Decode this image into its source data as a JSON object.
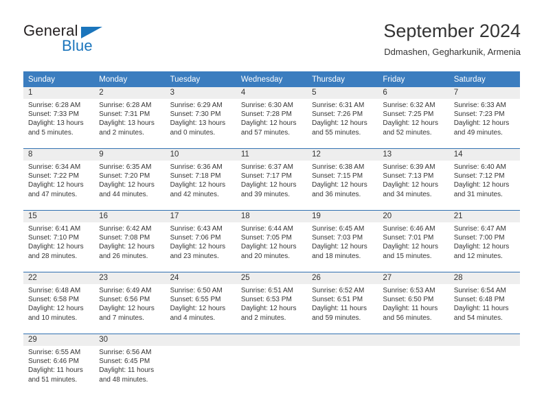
{
  "brand": {
    "name_part1": "General",
    "name_part2": "Blue",
    "flag_icon": "flag-triangle-icon"
  },
  "header": {
    "title": "September 2024",
    "subtitle": "Ddmashen, Gegharkunik, Armenia"
  },
  "colors": {
    "header_blue": "#3b7dbf",
    "row_divider_blue": "#2f6fb0",
    "daynum_band": "#eeeeee",
    "brand_blue": "#1b75bc",
    "text": "#333333"
  },
  "calendar": {
    "weekday_headers": [
      "Sunday",
      "Monday",
      "Tuesday",
      "Wednesday",
      "Thursday",
      "Friday",
      "Saturday"
    ],
    "weeks": [
      [
        {
          "day": "1",
          "sunrise": "Sunrise: 6:28 AM",
          "sunset": "Sunset: 7:33 PM",
          "daylight_line1": "Daylight: 13 hours",
          "daylight_line2": "and 5 minutes."
        },
        {
          "day": "2",
          "sunrise": "Sunrise: 6:28 AM",
          "sunset": "Sunset: 7:31 PM",
          "daylight_line1": "Daylight: 13 hours",
          "daylight_line2": "and 2 minutes."
        },
        {
          "day": "3",
          "sunrise": "Sunrise: 6:29 AM",
          "sunset": "Sunset: 7:30 PM",
          "daylight_line1": "Daylight: 13 hours",
          "daylight_line2": "and 0 minutes."
        },
        {
          "day": "4",
          "sunrise": "Sunrise: 6:30 AM",
          "sunset": "Sunset: 7:28 PM",
          "daylight_line1": "Daylight: 12 hours",
          "daylight_line2": "and 57 minutes."
        },
        {
          "day": "5",
          "sunrise": "Sunrise: 6:31 AM",
          "sunset": "Sunset: 7:26 PM",
          "daylight_line1": "Daylight: 12 hours",
          "daylight_line2": "and 55 minutes."
        },
        {
          "day": "6",
          "sunrise": "Sunrise: 6:32 AM",
          "sunset": "Sunset: 7:25 PM",
          "daylight_line1": "Daylight: 12 hours",
          "daylight_line2": "and 52 minutes."
        },
        {
          "day": "7",
          "sunrise": "Sunrise: 6:33 AM",
          "sunset": "Sunset: 7:23 PM",
          "daylight_line1": "Daylight: 12 hours",
          "daylight_line2": "and 49 minutes."
        }
      ],
      [
        {
          "day": "8",
          "sunrise": "Sunrise: 6:34 AM",
          "sunset": "Sunset: 7:22 PM",
          "daylight_line1": "Daylight: 12 hours",
          "daylight_line2": "and 47 minutes."
        },
        {
          "day": "9",
          "sunrise": "Sunrise: 6:35 AM",
          "sunset": "Sunset: 7:20 PM",
          "daylight_line1": "Daylight: 12 hours",
          "daylight_line2": "and 44 minutes."
        },
        {
          "day": "10",
          "sunrise": "Sunrise: 6:36 AM",
          "sunset": "Sunset: 7:18 PM",
          "daylight_line1": "Daylight: 12 hours",
          "daylight_line2": "and 42 minutes."
        },
        {
          "day": "11",
          "sunrise": "Sunrise: 6:37 AM",
          "sunset": "Sunset: 7:17 PM",
          "daylight_line1": "Daylight: 12 hours",
          "daylight_line2": "and 39 minutes."
        },
        {
          "day": "12",
          "sunrise": "Sunrise: 6:38 AM",
          "sunset": "Sunset: 7:15 PM",
          "daylight_line1": "Daylight: 12 hours",
          "daylight_line2": "and 36 minutes."
        },
        {
          "day": "13",
          "sunrise": "Sunrise: 6:39 AM",
          "sunset": "Sunset: 7:13 PM",
          "daylight_line1": "Daylight: 12 hours",
          "daylight_line2": "and 34 minutes."
        },
        {
          "day": "14",
          "sunrise": "Sunrise: 6:40 AM",
          "sunset": "Sunset: 7:12 PM",
          "daylight_line1": "Daylight: 12 hours",
          "daylight_line2": "and 31 minutes."
        }
      ],
      [
        {
          "day": "15",
          "sunrise": "Sunrise: 6:41 AM",
          "sunset": "Sunset: 7:10 PM",
          "daylight_line1": "Daylight: 12 hours",
          "daylight_line2": "and 28 minutes."
        },
        {
          "day": "16",
          "sunrise": "Sunrise: 6:42 AM",
          "sunset": "Sunset: 7:08 PM",
          "daylight_line1": "Daylight: 12 hours",
          "daylight_line2": "and 26 minutes."
        },
        {
          "day": "17",
          "sunrise": "Sunrise: 6:43 AM",
          "sunset": "Sunset: 7:06 PM",
          "daylight_line1": "Daylight: 12 hours",
          "daylight_line2": "and 23 minutes."
        },
        {
          "day": "18",
          "sunrise": "Sunrise: 6:44 AM",
          "sunset": "Sunset: 7:05 PM",
          "daylight_line1": "Daylight: 12 hours",
          "daylight_line2": "and 20 minutes."
        },
        {
          "day": "19",
          "sunrise": "Sunrise: 6:45 AM",
          "sunset": "Sunset: 7:03 PM",
          "daylight_line1": "Daylight: 12 hours",
          "daylight_line2": "and 18 minutes."
        },
        {
          "day": "20",
          "sunrise": "Sunrise: 6:46 AM",
          "sunset": "Sunset: 7:01 PM",
          "daylight_line1": "Daylight: 12 hours",
          "daylight_line2": "and 15 minutes."
        },
        {
          "day": "21",
          "sunrise": "Sunrise: 6:47 AM",
          "sunset": "Sunset: 7:00 PM",
          "daylight_line1": "Daylight: 12 hours",
          "daylight_line2": "and 12 minutes."
        }
      ],
      [
        {
          "day": "22",
          "sunrise": "Sunrise: 6:48 AM",
          "sunset": "Sunset: 6:58 PM",
          "daylight_line1": "Daylight: 12 hours",
          "daylight_line2": "and 10 minutes."
        },
        {
          "day": "23",
          "sunrise": "Sunrise: 6:49 AM",
          "sunset": "Sunset: 6:56 PM",
          "daylight_line1": "Daylight: 12 hours",
          "daylight_line2": "and 7 minutes."
        },
        {
          "day": "24",
          "sunrise": "Sunrise: 6:50 AM",
          "sunset": "Sunset: 6:55 PM",
          "daylight_line1": "Daylight: 12 hours",
          "daylight_line2": "and 4 minutes."
        },
        {
          "day": "25",
          "sunrise": "Sunrise: 6:51 AM",
          "sunset": "Sunset: 6:53 PM",
          "daylight_line1": "Daylight: 12 hours",
          "daylight_line2": "and 2 minutes."
        },
        {
          "day": "26",
          "sunrise": "Sunrise: 6:52 AM",
          "sunset": "Sunset: 6:51 PM",
          "daylight_line1": "Daylight: 11 hours",
          "daylight_line2": "and 59 minutes."
        },
        {
          "day": "27",
          "sunrise": "Sunrise: 6:53 AM",
          "sunset": "Sunset: 6:50 PM",
          "daylight_line1": "Daylight: 11 hours",
          "daylight_line2": "and 56 minutes."
        },
        {
          "day": "28",
          "sunrise": "Sunrise: 6:54 AM",
          "sunset": "Sunset: 6:48 PM",
          "daylight_line1": "Daylight: 11 hours",
          "daylight_line2": "and 54 minutes."
        }
      ],
      [
        {
          "day": "29",
          "sunrise": "Sunrise: 6:55 AM",
          "sunset": "Sunset: 6:46 PM",
          "daylight_line1": "Daylight: 11 hours",
          "daylight_line2": "and 51 minutes."
        },
        {
          "day": "30",
          "sunrise": "Sunrise: 6:56 AM",
          "sunset": "Sunset: 6:45 PM",
          "daylight_line1": "Daylight: 11 hours",
          "daylight_line2": "and 48 minutes."
        },
        {
          "day": "",
          "sunrise": "",
          "sunset": "",
          "daylight_line1": "",
          "daylight_line2": ""
        },
        {
          "day": "",
          "sunrise": "",
          "sunset": "",
          "daylight_line1": "",
          "daylight_line2": ""
        },
        {
          "day": "",
          "sunrise": "",
          "sunset": "",
          "daylight_line1": "",
          "daylight_line2": ""
        },
        {
          "day": "",
          "sunrise": "",
          "sunset": "",
          "daylight_line1": "",
          "daylight_line2": ""
        },
        {
          "day": "",
          "sunrise": "",
          "sunset": "",
          "daylight_line1": "",
          "daylight_line2": ""
        }
      ]
    ]
  }
}
